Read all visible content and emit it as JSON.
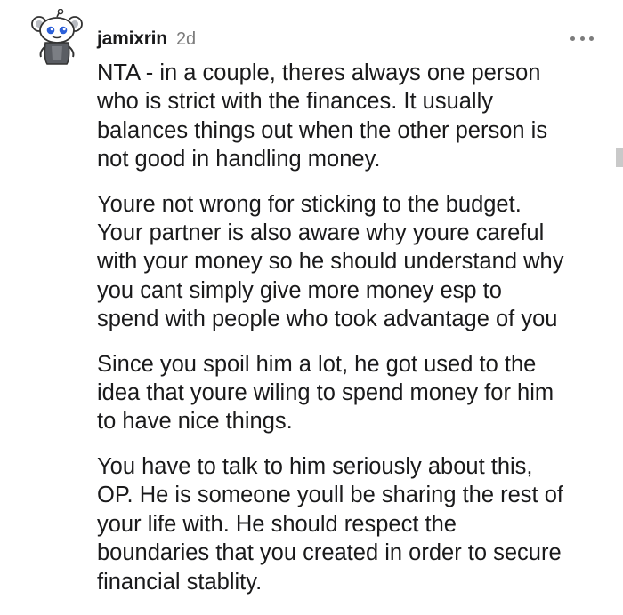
{
  "comment": {
    "username": "jamixrin",
    "timestamp": "2d",
    "paragraphs": [
      {
        "lines": [
          "NTA - in a couple, theres always one person",
          "who is strict with the finances. It usually",
          "balances things out when the other person is",
          "not good in handling money."
        ]
      },
      {
        "lines": [
          "Youre not wrong for sticking to the budget.",
          "Your partner is also aware why youre careful",
          "with your money so he should understand why",
          "you cant simply give more money esp to",
          "spend with people who took advantage of you"
        ]
      },
      {
        "lines": [
          "Since you spoil him a lot, he got used to the",
          "idea that youre wiling to spend money for him",
          "to have nice things."
        ]
      },
      {
        "lines": [
          "You have to talk to him seriously about this,",
          "OP. He is someone youll be sharing the rest of",
          "your life with. He should respect the",
          "boundaries that you created in order to secure",
          "financial stablity."
        ]
      }
    ]
  },
  "icons": {
    "avatar": "reddit-snoo-avatar-icon",
    "more": "more-options-icon"
  }
}
